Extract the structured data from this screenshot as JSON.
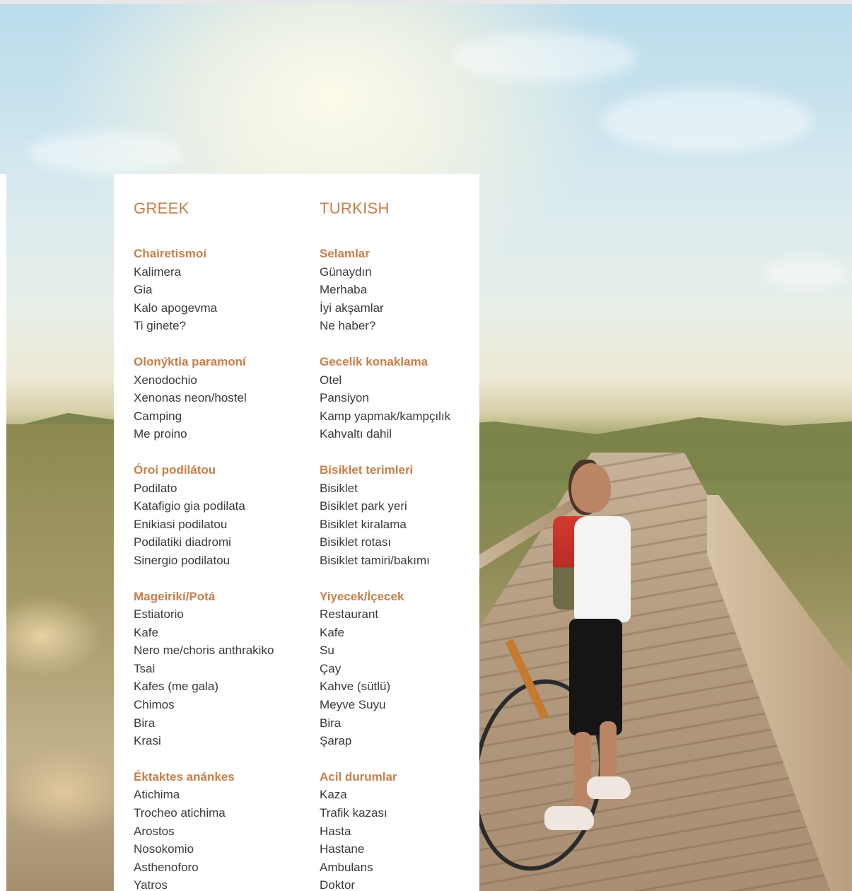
{
  "background": {
    "description_icon": "cyclist-photo"
  },
  "colors": {
    "accent": "#c77f4b",
    "text": "#3a3a3a",
    "card": "#ffffff"
  },
  "greek": {
    "title": "GREEK",
    "sections": [
      {
        "title": "Chairetismoí",
        "terms": [
          "Kalimera",
          "Gia",
          "Kalo apogevma",
          "Ti ginete?"
        ]
      },
      {
        "title": "Olonýktia paramoní",
        "terms": [
          "Xenodochio",
          "Xenonas neon/hostel",
          "Camping",
          "Me proino"
        ]
      },
      {
        "title": "Óroi podilátou",
        "terms": [
          "Podilato",
          "Katafigio gia podilata",
          "Enikiasi podilatou",
          "Podilatiki diadromi",
          "Sinergio podilatou"
        ]
      },
      {
        "title": "Mageirikí/Potá",
        "terms": [
          "Estiatorio",
          "Kafe",
          "Nero me/choris anthrakiko",
          "Tsai",
          "Kafes (me gala)",
          "Chimos",
          "Bira",
          "Krasi"
        ]
      },
      {
        "title": "Éktaktes anánkes",
        "terms": [
          "Atichima",
          "Trocheo atichima",
          "Arostos",
          "Nosokomio",
          "Asthenoforo",
          "Yatros"
        ]
      }
    ]
  },
  "turkish": {
    "title": "TURKISH",
    "sections": [
      {
        "title": "Selamlar",
        "terms": [
          "Günaydın",
          "Merhaba",
          "İyi akşamlar",
          "Ne haber?"
        ]
      },
      {
        "title": "Gecelik konaklama",
        "terms": [
          "Otel",
          "Pansiyon",
          "Kamp yapmak/kampçılık",
          "Kahvaltı dahil"
        ]
      },
      {
        "title": "Bisiklet terimleri",
        "terms": [
          "Bisiklet",
          "Bisiklet park yeri",
          "Bisiklet kiralama",
          "Bisiklet rotası",
          "Bisiklet tamiri/bakımı"
        ]
      },
      {
        "title": "Yiyecek/İçecek",
        "terms": [
          "Restaurant",
          "Kafe",
          "Su",
          "Çay",
          "Kahve (sütlü)",
          "Meyve Suyu",
          "Bira",
          "Şarap"
        ]
      },
      {
        "title": "Acil durumlar",
        "terms": [
          "Kaza",
          "Trafik kazası",
          "Hasta",
          "Hastane",
          "Ambulans",
          "Doktor"
        ]
      }
    ]
  }
}
